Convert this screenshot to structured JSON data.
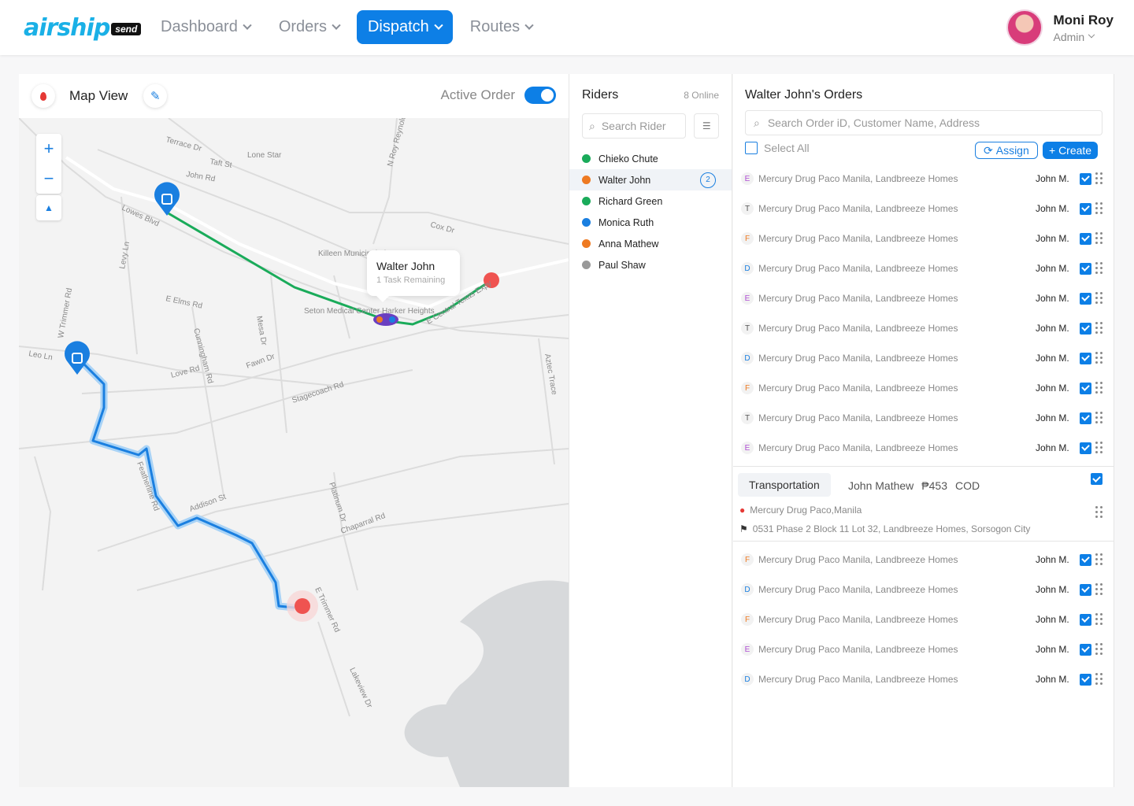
{
  "brand": {
    "name": "airship",
    "badge": "send"
  },
  "nav": [
    {
      "label": "Dashboard",
      "active": false
    },
    {
      "label": "Orders",
      "active": false
    },
    {
      "label": "Dispatch",
      "active": true
    },
    {
      "label": "Routes",
      "active": false
    }
  ],
  "user": {
    "name": "Moni Roy",
    "role": "Admin"
  },
  "map": {
    "title": "Map View",
    "active_order_label": "Active Order",
    "active_order_on": true,
    "tooltip": {
      "name": "Walter John",
      "sub": "1 Task Remaining"
    },
    "labels": [
      "Lone Star",
      "Killeen Municipal Airport",
      "Seton Medical Center Harker Heights",
      "E Elms Rd",
      "Stagecoach Rd",
      "Fawn Dr",
      "Addison St",
      "Chaparral Rd",
      "Cox Dr",
      "E Central Texas Expy",
      "Levy Ln",
      "Love Rd",
      "Platinum Dr",
      "Lakeview Dr",
      "Aztec Trace",
      "Mesa Dr",
      "Cunningham Rd",
      "Lowes Blvd",
      "Terrace Dr",
      "Taft St",
      "John Rd",
      "N Roy Reynolds Dr",
      "W Trimmer Rd",
      "E Trimmer Rd",
      "Featherline Rd",
      "Leo Ln"
    ],
    "route_green_color": "#1aab5a",
    "route_blue_color": "#1a7fe0"
  },
  "riders": {
    "title": "Riders",
    "online": "8 Online",
    "search_placeholder": "Search Rider",
    "list": [
      {
        "name": "Chieko Chute",
        "color": "#1aab5a",
        "selected": false,
        "badge": ""
      },
      {
        "name": "Walter John",
        "color": "#ee7a22",
        "selected": true,
        "badge": "2"
      },
      {
        "name": "Richard Green",
        "color": "#1aab5a",
        "selected": false,
        "badge": ""
      },
      {
        "name": "Monica Ruth",
        "color": "#1a7fe0",
        "selected": false,
        "badge": ""
      },
      {
        "name": "Anna Mathew",
        "color": "#ee7a22",
        "selected": false,
        "badge": ""
      },
      {
        "name": "Paul Shaw",
        "color": "#999999",
        "selected": false,
        "badge": ""
      }
    ]
  },
  "orders": {
    "title": "Walter John's Orders",
    "search_placeholder": "Search Order iD, Customer Name, Address",
    "select_all": "Select All",
    "assign": "Assign",
    "create": "+ Create",
    "rows_top": [
      {
        "letter": "E",
        "color": "#b04fd4",
        "address": "Mercury Drug Paco Manila,  Landbreeze Homes",
        "assignee": "John M."
      },
      {
        "letter": "T",
        "color": "#555555",
        "address": "Mercury Drug Paco Manila,  Landbreeze Homes",
        "assignee": "John M."
      },
      {
        "letter": "F",
        "color": "#ee7a22",
        "address": "Mercury Drug Paco Manila,  Landbreeze Homes",
        "assignee": "John M."
      },
      {
        "letter": "D",
        "color": "#1a7fe0",
        "address": "Mercury Drug Paco Manila,  Landbreeze Homes",
        "assignee": "John M."
      },
      {
        "letter": "E",
        "color": "#b04fd4",
        "address": "Mercury Drug Paco Manila,  Landbreeze Homes",
        "assignee": "John M."
      },
      {
        "letter": "T",
        "color": "#555555",
        "address": "Mercury Drug Paco Manila,  Landbreeze Homes",
        "assignee": "John M."
      },
      {
        "letter": "D",
        "color": "#1a7fe0",
        "address": "Mercury Drug Paco Manila,  Landbreeze Homes",
        "assignee": "John M."
      },
      {
        "letter": "F",
        "color": "#ee7a22",
        "address": "Mercury Drug Paco Manila,  Landbreeze Homes",
        "assignee": "John M."
      },
      {
        "letter": "T",
        "color": "#555555",
        "address": "Mercury Drug Paco Manila,  Landbreeze Homes",
        "assignee": "John M."
      },
      {
        "letter": "E",
        "color": "#b04fd4",
        "address": "Mercury Drug Paco Manila,  Landbreeze Homes",
        "assignee": "John M."
      }
    ],
    "expanded": {
      "tag": "Transportation",
      "customer": "John Mathew",
      "amount": "₱453",
      "payment": "COD",
      "pickup": "Mercury Drug Paco,Manila",
      "dropoff": "0531 Phase 2 Block 11 Lot 32, Landbreeze Homes, Sorsogon City"
    },
    "rows_bottom": [
      {
        "letter": "F",
        "color": "#ee7a22",
        "address": "Mercury Drug Paco Manila,  Landbreeze Homes",
        "assignee": "John M."
      },
      {
        "letter": "D",
        "color": "#1a7fe0",
        "address": "Mercury Drug Paco Manila,  Landbreeze Homes",
        "assignee": "John M."
      },
      {
        "letter": "F",
        "color": "#ee7a22",
        "address": "Mercury Drug Paco Manila,  Landbreeze Homes",
        "assignee": "John M."
      },
      {
        "letter": "E",
        "color": "#b04fd4",
        "address": "Mercury Drug Paco Manila,  Landbreeze Homes",
        "assignee": "John M."
      },
      {
        "letter": "D",
        "color": "#1a7fe0",
        "address": "Mercury Drug Paco Manila,  Landbreeze Homes",
        "assignee": "John M."
      }
    ]
  }
}
